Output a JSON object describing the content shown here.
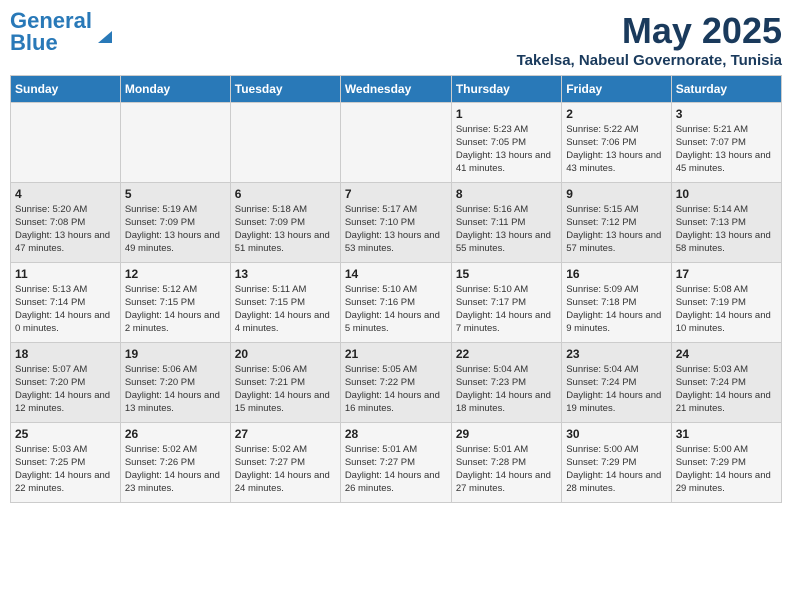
{
  "logo": {
    "line1": "General",
    "line2": "Blue"
  },
  "title": "May 2025",
  "location": "Takelsa, Nabeul Governorate, Tunisia",
  "weekdays": [
    "Sunday",
    "Monday",
    "Tuesday",
    "Wednesday",
    "Thursday",
    "Friday",
    "Saturday"
  ],
  "weeks": [
    [
      {
        "day": "",
        "info": ""
      },
      {
        "day": "",
        "info": ""
      },
      {
        "day": "",
        "info": ""
      },
      {
        "day": "",
        "info": ""
      },
      {
        "day": "1",
        "info": "Sunrise: 5:23 AM\nSunset: 7:05 PM\nDaylight: 13 hours and 41 minutes."
      },
      {
        "day": "2",
        "info": "Sunrise: 5:22 AM\nSunset: 7:06 PM\nDaylight: 13 hours and 43 minutes."
      },
      {
        "day": "3",
        "info": "Sunrise: 5:21 AM\nSunset: 7:07 PM\nDaylight: 13 hours and 45 minutes."
      }
    ],
    [
      {
        "day": "4",
        "info": "Sunrise: 5:20 AM\nSunset: 7:08 PM\nDaylight: 13 hours and 47 minutes."
      },
      {
        "day": "5",
        "info": "Sunrise: 5:19 AM\nSunset: 7:09 PM\nDaylight: 13 hours and 49 minutes."
      },
      {
        "day": "6",
        "info": "Sunrise: 5:18 AM\nSunset: 7:09 PM\nDaylight: 13 hours and 51 minutes."
      },
      {
        "day": "7",
        "info": "Sunrise: 5:17 AM\nSunset: 7:10 PM\nDaylight: 13 hours and 53 minutes."
      },
      {
        "day": "8",
        "info": "Sunrise: 5:16 AM\nSunset: 7:11 PM\nDaylight: 13 hours and 55 minutes."
      },
      {
        "day": "9",
        "info": "Sunrise: 5:15 AM\nSunset: 7:12 PM\nDaylight: 13 hours and 57 minutes."
      },
      {
        "day": "10",
        "info": "Sunrise: 5:14 AM\nSunset: 7:13 PM\nDaylight: 13 hours and 58 minutes."
      }
    ],
    [
      {
        "day": "11",
        "info": "Sunrise: 5:13 AM\nSunset: 7:14 PM\nDaylight: 14 hours and 0 minutes."
      },
      {
        "day": "12",
        "info": "Sunrise: 5:12 AM\nSunset: 7:15 PM\nDaylight: 14 hours and 2 minutes."
      },
      {
        "day": "13",
        "info": "Sunrise: 5:11 AM\nSunset: 7:15 PM\nDaylight: 14 hours and 4 minutes."
      },
      {
        "day": "14",
        "info": "Sunrise: 5:10 AM\nSunset: 7:16 PM\nDaylight: 14 hours and 5 minutes."
      },
      {
        "day": "15",
        "info": "Sunrise: 5:10 AM\nSunset: 7:17 PM\nDaylight: 14 hours and 7 minutes."
      },
      {
        "day": "16",
        "info": "Sunrise: 5:09 AM\nSunset: 7:18 PM\nDaylight: 14 hours and 9 minutes."
      },
      {
        "day": "17",
        "info": "Sunrise: 5:08 AM\nSunset: 7:19 PM\nDaylight: 14 hours and 10 minutes."
      }
    ],
    [
      {
        "day": "18",
        "info": "Sunrise: 5:07 AM\nSunset: 7:20 PM\nDaylight: 14 hours and 12 minutes."
      },
      {
        "day": "19",
        "info": "Sunrise: 5:06 AM\nSunset: 7:20 PM\nDaylight: 14 hours and 13 minutes."
      },
      {
        "day": "20",
        "info": "Sunrise: 5:06 AM\nSunset: 7:21 PM\nDaylight: 14 hours and 15 minutes."
      },
      {
        "day": "21",
        "info": "Sunrise: 5:05 AM\nSunset: 7:22 PM\nDaylight: 14 hours and 16 minutes."
      },
      {
        "day": "22",
        "info": "Sunrise: 5:04 AM\nSunset: 7:23 PM\nDaylight: 14 hours and 18 minutes."
      },
      {
        "day": "23",
        "info": "Sunrise: 5:04 AM\nSunset: 7:24 PM\nDaylight: 14 hours and 19 minutes."
      },
      {
        "day": "24",
        "info": "Sunrise: 5:03 AM\nSunset: 7:24 PM\nDaylight: 14 hours and 21 minutes."
      }
    ],
    [
      {
        "day": "25",
        "info": "Sunrise: 5:03 AM\nSunset: 7:25 PM\nDaylight: 14 hours and 22 minutes."
      },
      {
        "day": "26",
        "info": "Sunrise: 5:02 AM\nSunset: 7:26 PM\nDaylight: 14 hours and 23 minutes."
      },
      {
        "day": "27",
        "info": "Sunrise: 5:02 AM\nSunset: 7:27 PM\nDaylight: 14 hours and 24 minutes."
      },
      {
        "day": "28",
        "info": "Sunrise: 5:01 AM\nSunset: 7:27 PM\nDaylight: 14 hours and 26 minutes."
      },
      {
        "day": "29",
        "info": "Sunrise: 5:01 AM\nSunset: 7:28 PM\nDaylight: 14 hours and 27 minutes."
      },
      {
        "day": "30",
        "info": "Sunrise: 5:00 AM\nSunset: 7:29 PM\nDaylight: 14 hours and 28 minutes."
      },
      {
        "day": "31",
        "info": "Sunrise: 5:00 AM\nSunset: 7:29 PM\nDaylight: 14 hours and 29 minutes."
      }
    ]
  ]
}
